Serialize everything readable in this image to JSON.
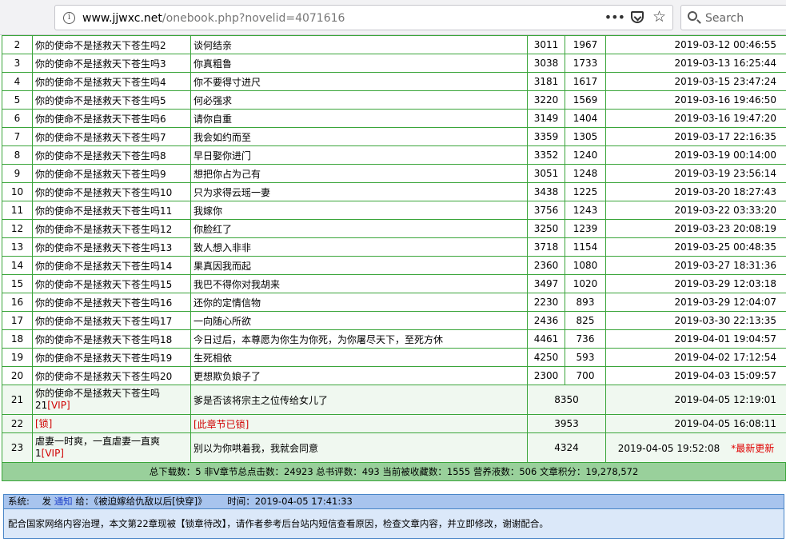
{
  "browser": {
    "url_domain": "www.jjwxc.net",
    "url_path": "/onebook.php?novelid=4071616",
    "search_placeholder": "Search"
  },
  "chapters": [
    {
      "no": "2",
      "title": "你的使命不是拯救天下苍生吗2",
      "summary": "谈何结亲",
      "words": "3011",
      "clicks": "1967",
      "date": "2019-03-12 00:46:55"
    },
    {
      "no": "3",
      "title": "你的使命不是拯救天下苍生吗3",
      "summary": "你真粗鲁",
      "words": "3038",
      "clicks": "1733",
      "date": "2019-03-13 16:25:44"
    },
    {
      "no": "4",
      "title": "你的使命不是拯救天下苍生吗4",
      "summary": "你不要得寸进尺",
      "words": "3181",
      "clicks": "1617",
      "date": "2019-03-15 23:47:24"
    },
    {
      "no": "5",
      "title": "你的使命不是拯救天下苍生吗5",
      "summary": "何必强求",
      "words": "3220",
      "clicks": "1569",
      "date": "2019-03-16 19:46:50"
    },
    {
      "no": "6",
      "title": "你的使命不是拯救天下苍生吗6",
      "summary": "请你自重",
      "words": "3149",
      "clicks": "1404",
      "date": "2019-03-16 19:47:20"
    },
    {
      "no": "7",
      "title": "你的使命不是拯救天下苍生吗7",
      "summary": "我会如约而至",
      "words": "3359",
      "clicks": "1305",
      "date": "2019-03-17 22:16:35"
    },
    {
      "no": "8",
      "title": "你的使命不是拯救天下苍生吗8",
      "summary": "早日娶你进门",
      "words": "3352",
      "clicks": "1240",
      "date": "2019-03-19 00:14:00"
    },
    {
      "no": "9",
      "title": "你的使命不是拯救天下苍生吗9",
      "summary": "想把你占为己有",
      "words": "3051",
      "clicks": "1248",
      "date": "2019-03-19 23:56:14"
    },
    {
      "no": "10",
      "title": "你的使命不是拯救天下苍生吗10",
      "summary": "只为求得云瑶一妻",
      "words": "3438",
      "clicks": "1225",
      "date": "2019-03-20 18:27:43"
    },
    {
      "no": "11",
      "title": "你的使命不是拯救天下苍生吗11",
      "summary": "我嫁你",
      "words": "3756",
      "clicks": "1243",
      "date": "2019-03-22 03:33:20"
    },
    {
      "no": "12",
      "title": "你的使命不是拯救天下苍生吗12",
      "summary": "你脸红了",
      "words": "3250",
      "clicks": "1239",
      "date": "2019-03-23 20:08:19"
    },
    {
      "no": "13",
      "title": "你的使命不是拯救天下苍生吗13",
      "summary": "致人想入非非",
      "words": "3718",
      "clicks": "1154",
      "date": "2019-03-25 00:48:35"
    },
    {
      "no": "14",
      "title": "你的使命不是拯救天下苍生吗14",
      "summary": "果真因我而起",
      "words": "2360",
      "clicks": "1080",
      "date": "2019-03-27 18:31:36"
    },
    {
      "no": "15",
      "title": "你的使命不是拯救天下苍生吗15",
      "summary": "我巴不得你对我胡来",
      "words": "3497",
      "clicks": "1020",
      "date": "2019-03-29 12:03:18"
    },
    {
      "no": "16",
      "title": "你的使命不是拯救天下苍生吗16",
      "summary": "还你的定情信物",
      "words": "2230",
      "clicks": "893",
      "date": "2019-03-29 12:04:07"
    },
    {
      "no": "17",
      "title": "你的使命不是拯救天下苍生吗17",
      "summary": "一向随心所欲",
      "words": "2436",
      "clicks": "825",
      "date": "2019-03-30 22:13:35"
    },
    {
      "no": "18",
      "title": "你的使命不是拯救天下苍生吗18",
      "summary": "今日过后，本尊愿为你生为你死，为你屠尽天下，至死方休",
      "words": "4461",
      "clicks": "736",
      "date": "2019-04-01 19:04:57"
    },
    {
      "no": "19",
      "title": "你的使命不是拯救天下苍生吗19",
      "summary": "生死相依",
      "words": "4250",
      "clicks": "593",
      "date": "2019-04-02 17:12:54"
    },
    {
      "no": "20",
      "title": "你的使命不是拯救天下苍生吗20",
      "summary": "更想欺负娘子了",
      "words": "2300",
      "clicks": "700",
      "date": "2019-04-03 15:09:57"
    }
  ],
  "vip_rows": [
    {
      "no": "21",
      "title": "你的使命不是拯救天下苍生吗",
      "title_2": "21",
      "vip": "[VIP]",
      "summary": "爹是否该将宗主之位传给女儿了",
      "words": "8350",
      "date": "2019-04-05 12:19:01"
    },
    {
      "no": "22",
      "title": "[锁]",
      "summary": "[此章节已锁]",
      "words": "3953",
      "date": "2019-04-05 16:08:11"
    },
    {
      "no": "23",
      "title": "虐妻一时爽，一直虐妻一直爽",
      "title_2": "1",
      "vip": "[VIP]",
      "summary": "别以为你哄着我，我就会同意",
      "words": "4324",
      "date": "2019-04-05 19:52:08",
      "new_flag": "*最新更新"
    }
  ],
  "summary_bar": "总下载数：5 非V章节总点击数：24923   总书评数：493 当前被收藏数：1555 营养液数：506 文章积分：19,278,572",
  "notice": {
    "label": "系统:",
    "send": "发",
    "link": "通知",
    "to": "给：《被迫嫁给仇敌以后[快穿]》",
    "time_label": "时间：",
    "time": "2019-04-05 17:41:33",
    "body": "配合国家网络内容治理，本文第22章现被【锁章待改】，请作者参考后台站内短信查看原因，检查文章内容，并立即修改，谢谢配合。"
  },
  "colors": {
    "border_green": "#3aa53a",
    "summary_green": "#99d09b",
    "notice_blue": "#a8c4ee",
    "vip_red": "#d00000"
  }
}
